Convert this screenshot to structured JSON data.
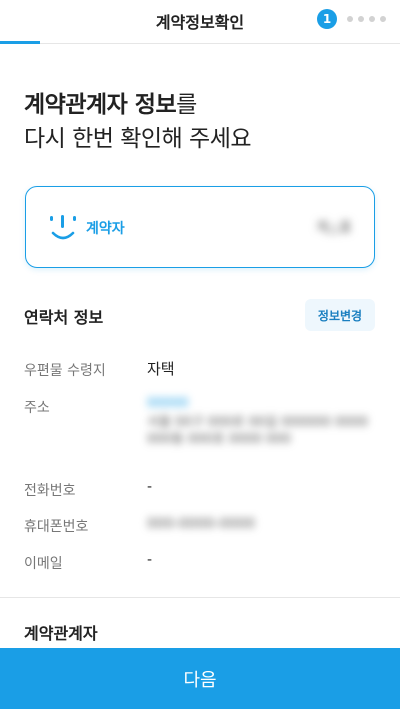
{
  "header": {
    "title": "계약정보확인",
    "current_step": "1",
    "remaining_steps": 4,
    "accent_color": "#1a9ee6"
  },
  "headline": {
    "bold": "계약관계자 정보",
    "line1_rest": "를",
    "line2": "다시 한번 확인해 주세요"
  },
  "contractor_card": {
    "icon": "smile-icon",
    "label": "계약자",
    "name_masked": "계△홍"
  },
  "contact_section": {
    "title": "연락처 정보",
    "edit_label": "정보변경",
    "rows": {
      "mail_receiver": {
        "label": "우편물 수령지",
        "value": "자택"
      },
      "address": {
        "label": "주소",
        "zip_masked": "00000",
        "address_masked": "서울 00구 000로 00길 000000 0000 000동 000호 0000 000"
      },
      "phone": {
        "label": "전화번호",
        "value": "-"
      },
      "mobile": {
        "label": "휴대폰번호",
        "value_masked": "000-0000-0000"
      },
      "email": {
        "label": "이메일",
        "value": "-"
      }
    }
  },
  "section2": {
    "title": "계약관계자"
  },
  "footer": {
    "next_label": "다음"
  }
}
